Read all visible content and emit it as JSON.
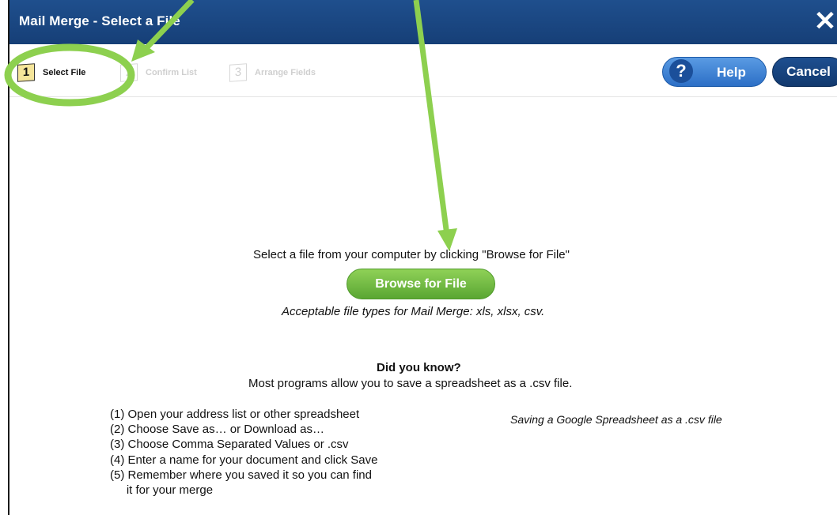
{
  "window": {
    "title": "Mail Merge - Select a File",
    "close_glyph": "✕"
  },
  "steps": [
    {
      "number": "1",
      "label": "Select File",
      "active": true
    },
    {
      "number": "2",
      "label": "Confirm List",
      "active": false
    },
    {
      "number": "3",
      "label": "Arrange Fields",
      "active": false
    }
  ],
  "toolbar": {
    "help_icon": "?",
    "help_label": "Help",
    "cancel_label": "Cancel"
  },
  "main": {
    "instruction": "Select a file from your computer by clicking \"Browse for File\"",
    "browse_label": "Browse for File",
    "filetypes_note": "Acceptable file types for Mail Merge: xls, xlsx, csv.",
    "did_you_know_title": "Did you know?",
    "did_you_know_text": "Most programs allow you to save a spreadsheet as a .csv file.",
    "csv_steps": [
      "(1) Open your address list or other spreadsheet",
      "(2) Choose Save as… or Download as…",
      "(3) Choose Comma Separated Values or .csv",
      "(4) Enter a name for your document and click Save",
      "(5) Remember where you saved it so you can find",
      "     it for your merge"
    ],
    "google_note": "Saving a Google Spreadsheet as a .csv file"
  },
  "colors": {
    "titlebar": "#1f4f8d",
    "browse_green": "#6cb33f",
    "annotation_green": "#8dd04f",
    "help_blue": "#3b82d6"
  }
}
